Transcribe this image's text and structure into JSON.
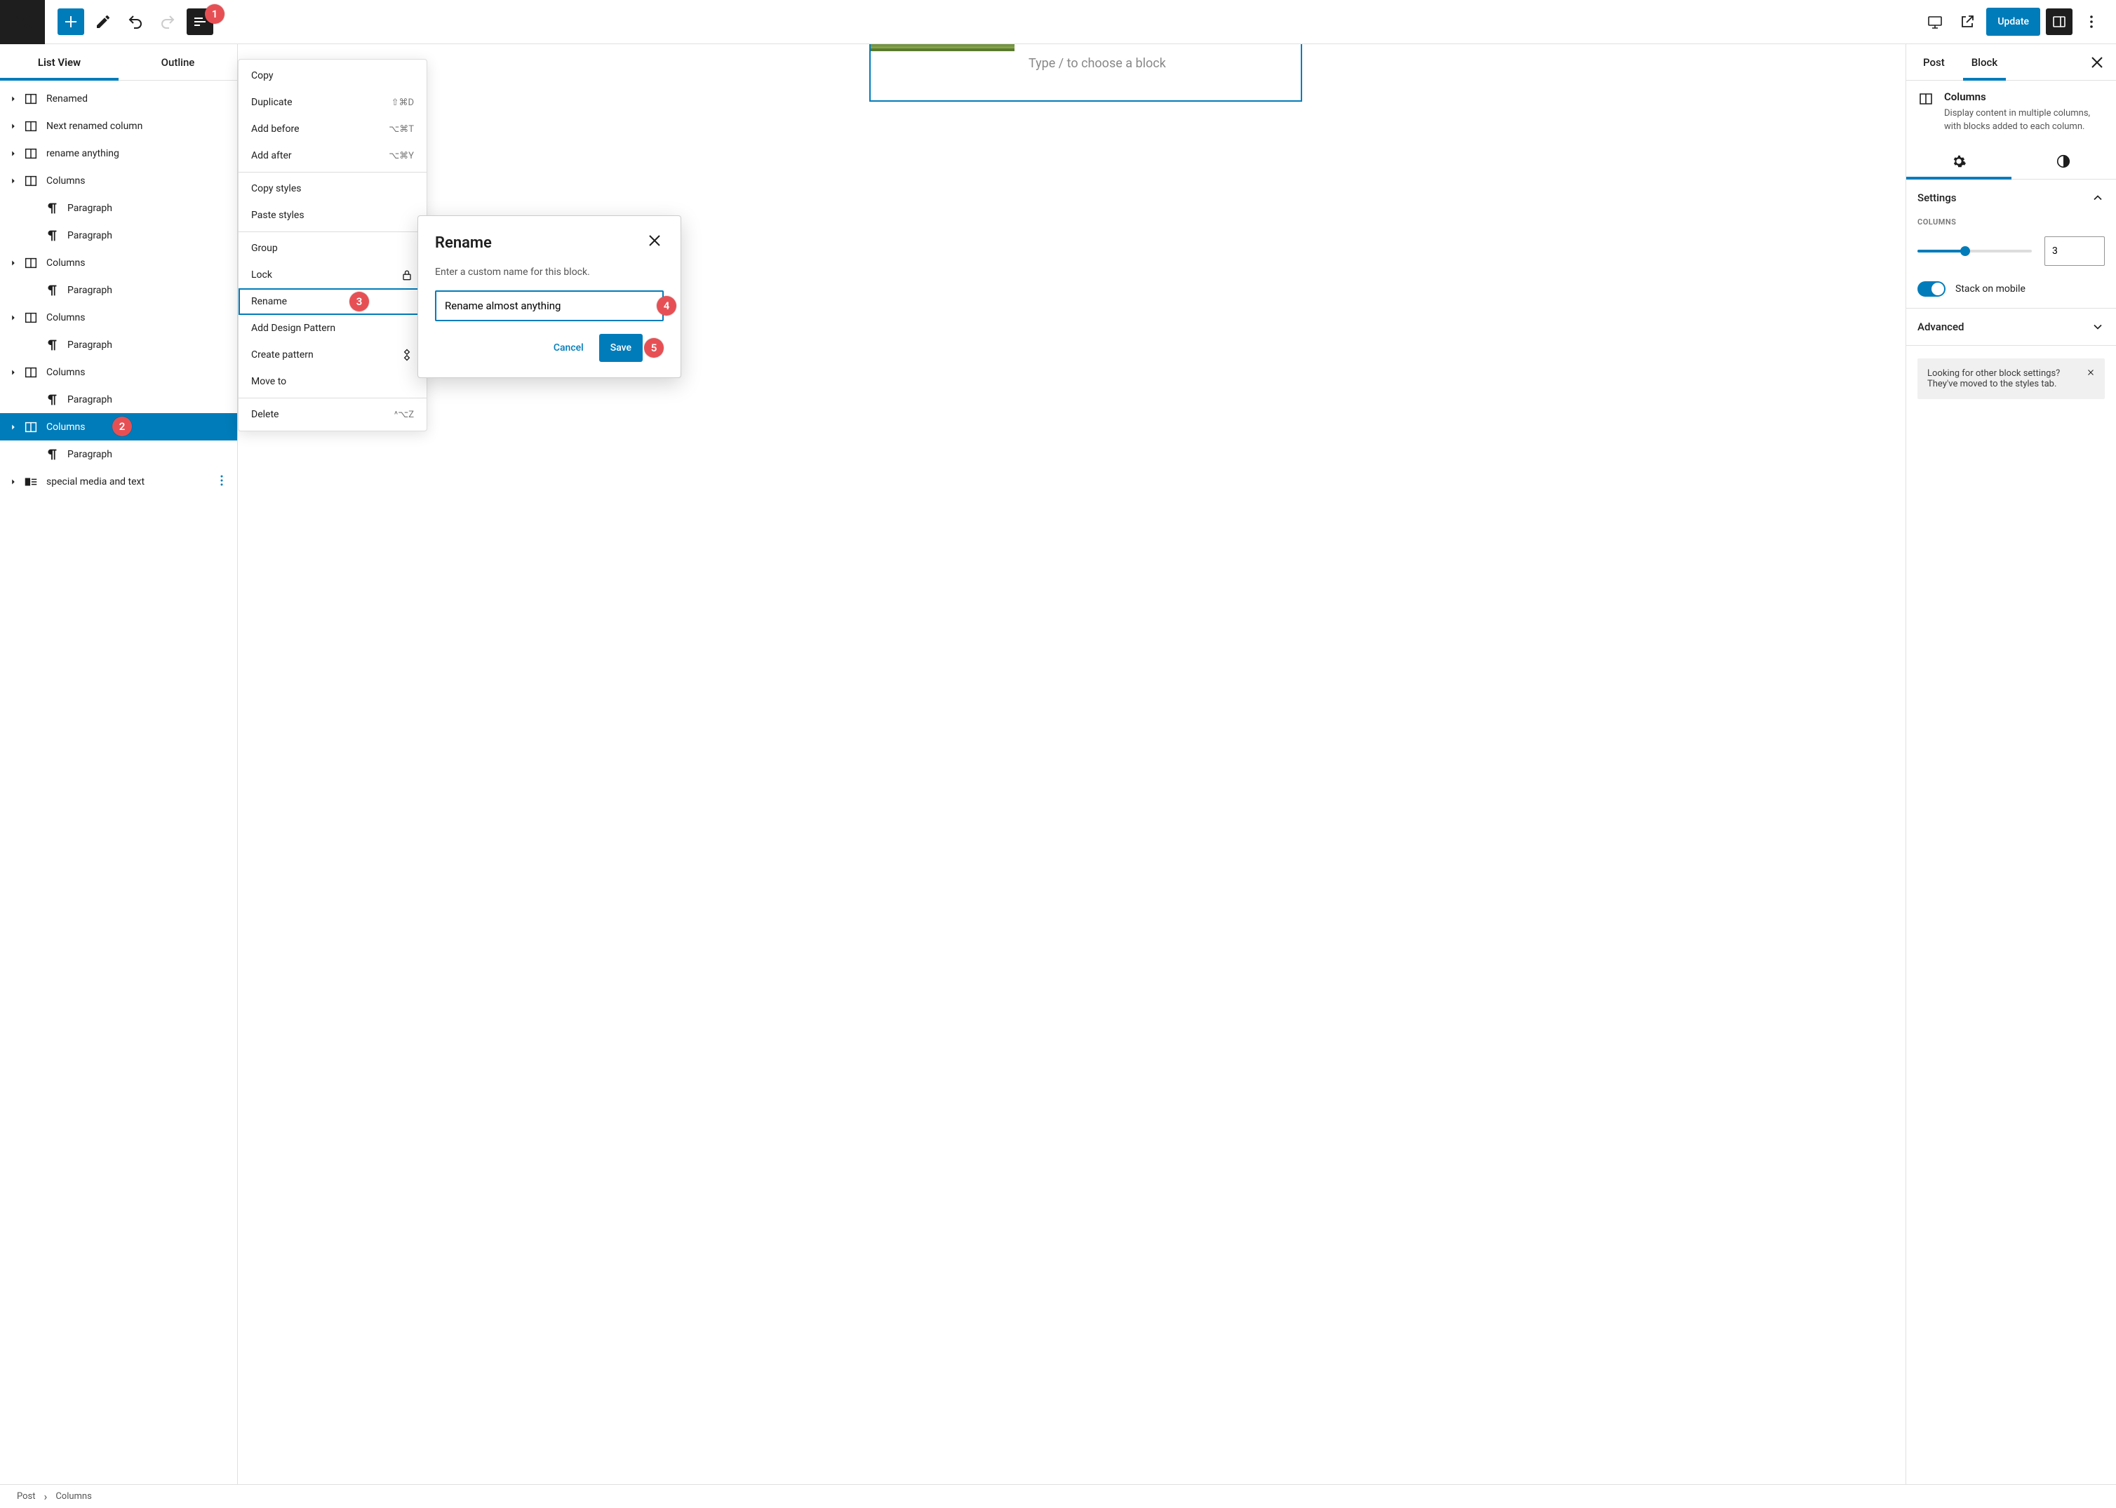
{
  "topbar": {
    "update_label": "Update"
  },
  "badges": [
    "1",
    "2",
    "3",
    "4",
    "5"
  ],
  "left": {
    "tabs": {
      "list": "List View",
      "outline": "Outline"
    },
    "tree": [
      {
        "icon": "columns",
        "label": "Renamed",
        "depth": 0,
        "caret": true
      },
      {
        "icon": "columns",
        "label": "Next renamed column",
        "depth": 0,
        "caret": true
      },
      {
        "icon": "columns",
        "label": "rename anything",
        "depth": 0,
        "caret": true
      },
      {
        "icon": "columns",
        "label": "Columns",
        "depth": 0,
        "caret": true
      },
      {
        "icon": "paragraph",
        "label": "Paragraph",
        "depth": 1,
        "caret": false
      },
      {
        "icon": "paragraph",
        "label": "Paragraph",
        "depth": 1,
        "caret": false
      },
      {
        "icon": "columns",
        "label": "Columns",
        "depth": 0,
        "caret": true
      },
      {
        "icon": "paragraph",
        "label": "Paragraph",
        "depth": 1,
        "caret": false
      },
      {
        "icon": "columns",
        "label": "Columns",
        "depth": 0,
        "caret": true
      },
      {
        "icon": "paragraph",
        "label": "Paragraph",
        "depth": 1,
        "caret": false
      },
      {
        "icon": "columns",
        "label": "Columns",
        "depth": 0,
        "caret": true
      },
      {
        "icon": "paragraph",
        "label": "Paragraph",
        "depth": 1,
        "caret": false
      },
      {
        "icon": "columns",
        "label": "Columns",
        "depth": 0,
        "caret": true,
        "selected": true
      },
      {
        "icon": "paragraph",
        "label": "Paragraph",
        "depth": 1,
        "caret": false
      },
      {
        "icon": "media-text",
        "label": "special media and text",
        "depth": 0,
        "caret": true,
        "more": true
      }
    ]
  },
  "canvas": {
    "placeholder": "Type / to choose a block"
  },
  "ctx": {
    "groups": [
      [
        {
          "label": "Copy"
        },
        {
          "label": "Duplicate",
          "kbd": "⇧⌘D"
        },
        {
          "label": "Add before",
          "kbd": "⌥⌘T"
        },
        {
          "label": "Add after",
          "kbd": "⌥⌘Y"
        }
      ],
      [
        {
          "label": "Copy styles"
        },
        {
          "label": "Paste styles"
        }
      ],
      [
        {
          "label": "Group"
        },
        {
          "label": "Lock",
          "icon": "lock"
        },
        {
          "label": "Rename",
          "highlight": true
        },
        {
          "label": "Add Design Pattern"
        },
        {
          "label": "Create pattern",
          "icon": "pattern"
        },
        {
          "label": "Move to"
        }
      ],
      [
        {
          "label": "Delete",
          "kbd": "^⌥Z"
        }
      ]
    ]
  },
  "modal": {
    "title": "Rename",
    "desc": "Enter a custom name for this block.",
    "value": "Rename almost anything",
    "cancel": "Cancel",
    "save": "Save"
  },
  "right": {
    "tabs": {
      "post": "Post",
      "block": "Block"
    },
    "block_title": "Columns",
    "block_desc": "Display content in multiple columns, with blocks added to each column.",
    "settings_heading": "Settings",
    "columns_label": "COLUMNS",
    "columns_value": "3",
    "stack_label": "Stack on mobile",
    "advanced_heading": "Advanced",
    "hint": "Looking for other block settings? They've moved to the styles tab."
  },
  "footer": {
    "crumbs": [
      "Post",
      "Columns"
    ]
  }
}
